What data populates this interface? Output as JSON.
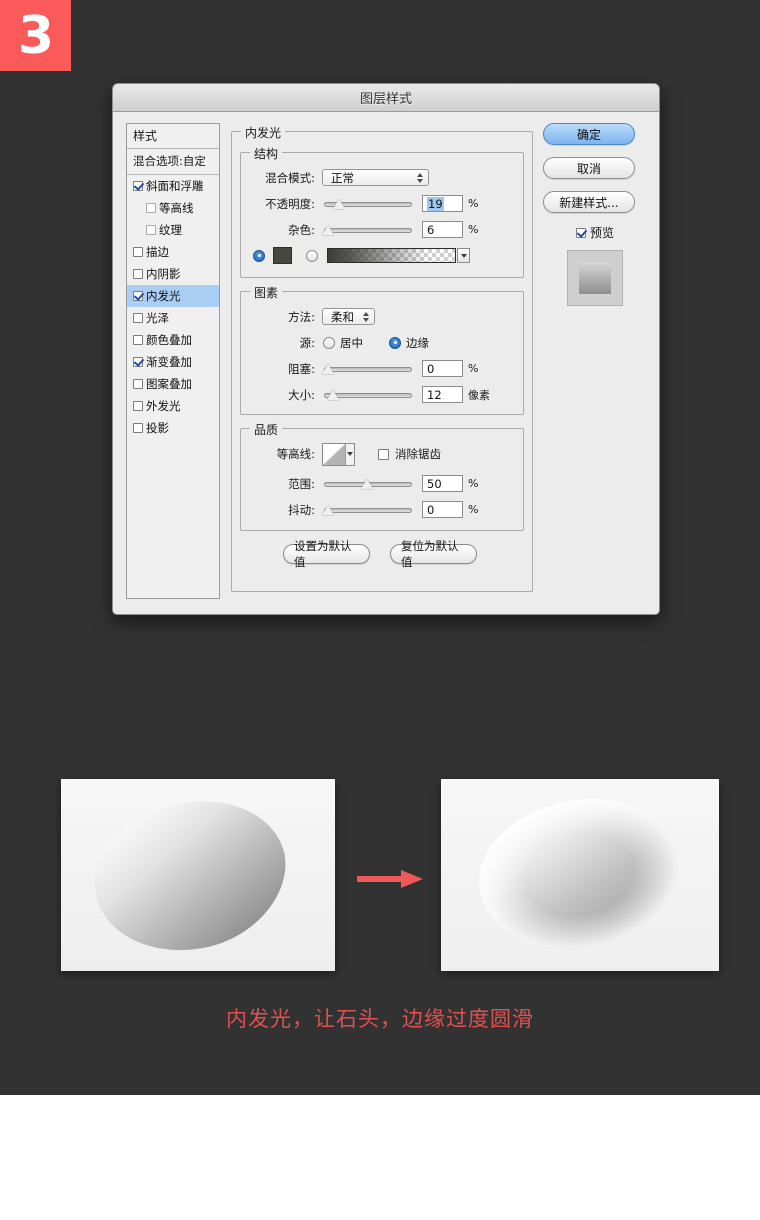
{
  "badge": {
    "number": "3"
  },
  "dialog": {
    "title": "图层样式",
    "style_list": {
      "header": "样式",
      "blend_options": "混合选项:自定",
      "items": [
        {
          "label": "斜面和浮雕",
          "checked": true,
          "indent": false,
          "selected": false
        },
        {
          "label": "等高线",
          "checked": false,
          "indent": true,
          "selected": false
        },
        {
          "label": "纹理",
          "checked": false,
          "indent": true,
          "selected": false
        },
        {
          "label": "描边",
          "checked": false,
          "indent": false,
          "selected": false
        },
        {
          "label": "内阴影",
          "checked": false,
          "indent": false,
          "selected": false
        },
        {
          "label": "内发光",
          "checked": true,
          "indent": false,
          "selected": true
        },
        {
          "label": "光泽",
          "checked": false,
          "indent": false,
          "selected": false
        },
        {
          "label": "颜色叠加",
          "checked": false,
          "indent": false,
          "selected": false
        },
        {
          "label": "渐变叠加",
          "checked": true,
          "indent": false,
          "selected": false
        },
        {
          "label": "图案叠加",
          "checked": false,
          "indent": false,
          "selected": false
        },
        {
          "label": "外发光",
          "checked": false,
          "indent": false,
          "selected": false
        },
        {
          "label": "投影",
          "checked": false,
          "indent": false,
          "selected": false
        }
      ]
    },
    "panel": {
      "title": "内发光",
      "structure": {
        "legend": "结构",
        "blend_mode_label": "混合模式:",
        "blend_mode_value": "正常",
        "opacity_label": "不透明度:",
        "opacity_value": "19",
        "opacity_unit": "%",
        "noise_label": "杂色:",
        "noise_value": "6",
        "noise_unit": "%",
        "fill_color": "#474740"
      },
      "elements": {
        "legend": "图素",
        "technique_label": "方法:",
        "technique_value": "柔和",
        "source_label": "源:",
        "source_center": "居中",
        "source_edge": "边缘",
        "source_selected": "边缘",
        "choke_label": "阻塞:",
        "choke_value": "0",
        "choke_unit": "%",
        "size_label": "大小:",
        "size_value": "12",
        "size_unit": "像素"
      },
      "quality": {
        "legend": "品质",
        "contour_label": "等高线:",
        "antialias_label": "消除锯齿",
        "antialias_checked": false,
        "range_label": "范围:",
        "range_value": "50",
        "range_unit": "%",
        "jitter_label": "抖动:",
        "jitter_value": "0",
        "jitter_unit": "%"
      },
      "footer": {
        "set_default": "设置为默认值",
        "reset_default": "复位为默认值"
      }
    },
    "buttons": {
      "ok": "确定",
      "cancel": "取消",
      "new_style": "新建样式...",
      "preview_label": "预览",
      "preview_checked": true
    }
  },
  "illustration": {
    "caption": "内发光，让石头，边缘过度圆滑",
    "arrow_color": "#ef5a58"
  },
  "colors": {
    "page_background": "#323232",
    "badge_background": "#fa5a5a",
    "accent_blue": "#aacdf4",
    "caption_red": "#e0514f"
  }
}
